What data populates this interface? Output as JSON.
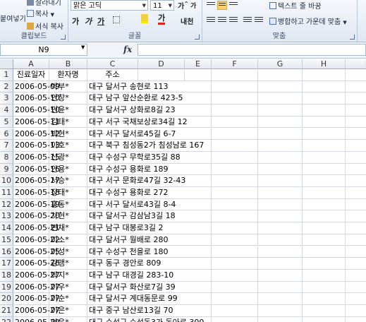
{
  "ribbon": {
    "clipboard": {
      "paste_label": "붙여넣기",
      "cut_label": "잘라내기",
      "copy_label": "복사",
      "format_painter_label": "서식 복사",
      "group_label": "클립보드"
    },
    "font": {
      "font_name": "맑은 고딕",
      "font_size": "11",
      "group_label": "글꼴",
      "bold": "가",
      "italic": "가",
      "underline": "가",
      "grow": "가",
      "shrink": "가",
      "font_color_glyph": "가",
      "phonetic": "내천"
    },
    "alignment": {
      "wrap_text_label": "텍스트 줄 바꿈",
      "merge_label": "병합하고 가운데 맞춤",
      "group_label": "맞춤"
    }
  },
  "formula_bar": {
    "name_box": "N9",
    "fx_label": "fx",
    "formula": ""
  },
  "columns": [
    "A",
    "B",
    "C",
    "D",
    "E",
    "F",
    "G",
    "H",
    "I"
  ],
  "rows": [
    {
      "n": "1",
      "a": "진료일자",
      "b": "환자명",
      "c": "주소"
    },
    {
      "n": "2",
      "a": "2006-05-09",
      "b": "박부*",
      "c": "대구 달서구 송현로 113"
    },
    {
      "n": "3",
      "a": "2006-05-10",
      "b": "안창*",
      "c": "대구 남구 앞산순환로 423-5"
    },
    {
      "n": "4",
      "a": "2006-05-10",
      "b": "민윤*",
      "c": "대구 달서구 상화로8길 23"
    },
    {
      "n": "5",
      "a": "2006-05-11",
      "b": "김태*",
      "c": "대구 서구 국채보상로34길 12"
    },
    {
      "n": "6",
      "a": "2006-05-12",
      "b": "박현*",
      "c": "대구 서구 달서로45길 6-7"
    },
    {
      "n": "7",
      "a": "2006-05-13",
      "b": "이호*",
      "c": "대구 북구 침성동2가 침성남로 167"
    },
    {
      "n": "8",
      "a": "2006-05-15",
      "b": "신광*",
      "c": "대구 수성구 무학로35길 88"
    },
    {
      "n": "9",
      "a": "2006-05-16",
      "b": "안용*",
      "c": "대구 수성구 용화로 189"
    },
    {
      "n": "10",
      "a": "2006-05-17",
      "b": "서승*",
      "c": "대구 서구 문화로47길 32-43"
    },
    {
      "n": "11",
      "a": "2006-05-18",
      "b": "장태*",
      "c": "대구 수성구 용화로 272"
    },
    {
      "n": "12",
      "a": "2006-05-19",
      "b": "홍동*",
      "c": "대구 서구 달서로43길 8-4"
    },
    {
      "n": "13",
      "a": "2006-05-20",
      "b": "차현*",
      "c": "대구 달서구 감삼남3길 18"
    },
    {
      "n": "14",
      "a": "2006-05-21",
      "b": "변채*",
      "c": "대구 남구 대봉로3길 2"
    },
    {
      "n": "15",
      "a": "2006-05-22",
      "b": "미소*",
      "c": "대구 달서구 월배로 280"
    },
    {
      "n": "16",
      "a": "2006-05-25",
      "b": "이성*",
      "c": "대구 수성구 천을로 180"
    },
    {
      "n": "17",
      "a": "2006-05-26",
      "b": "강맹*",
      "c": "대구 동구 경안로 809"
    },
    {
      "n": "18",
      "a": "2006-05-27",
      "b": "박지*",
      "c": "대구 남구 대경길 283-10"
    },
    {
      "n": "19",
      "a": "2006-05-27",
      "b": "이우*",
      "c": "대구 달서구 화산로7길 39"
    },
    {
      "n": "20",
      "a": "2006-05-27",
      "b": "이순*",
      "c": "대구 달서구 계대동문로 99"
    },
    {
      "n": "21",
      "a": "2006-05-27",
      "b": "이은*",
      "c": "대구 중구 남산로13길 70"
    },
    {
      "n": "22",
      "a": "2006-05-29",
      "b": "안윤*",
      "c": "대구 수성구 수성동3가 동아로 300"
    }
  ],
  "colors": {
    "ribbon_bg": "#dfe7f2",
    "header_bg": "#e4e9f0",
    "gridline": "#d4d9e0",
    "active_align": "#f8d46b"
  }
}
